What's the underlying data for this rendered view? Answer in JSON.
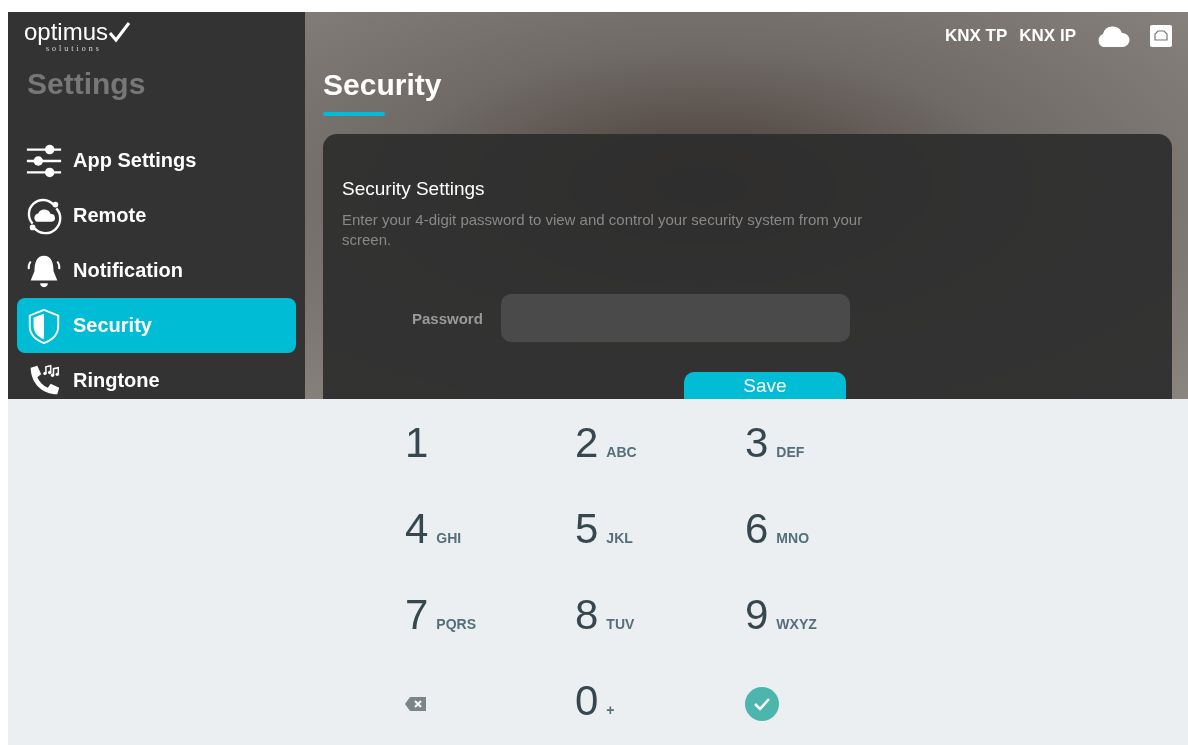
{
  "logo": {
    "name": "optimus",
    "tagline": "solutions"
  },
  "sidebar": {
    "title": "Settings",
    "items": [
      {
        "label": "App Settings",
        "selected": false
      },
      {
        "label": "Remote",
        "selected": false
      },
      {
        "label": "Notification",
        "selected": false
      },
      {
        "label": "Security",
        "selected": true
      },
      {
        "label": "Ringtone",
        "selected": false
      }
    ]
  },
  "status_bar": {
    "items": [
      "KNX TP",
      "KNX IP"
    ]
  },
  "page": {
    "title": "Security"
  },
  "card": {
    "title": "Security Settings",
    "description": "Enter your 4-digit password to view and control your security system from your screen.",
    "password_label": "Password",
    "save_button": "Save"
  },
  "keypad": {
    "keys": [
      {
        "kind": "digit",
        "digit": "1"
      },
      {
        "kind": "digit",
        "digit": "2",
        "letters": "ABC"
      },
      {
        "kind": "digit",
        "digit": "3",
        "letters": "DEF"
      },
      {
        "kind": "digit",
        "digit": "4",
        "letters": "GHI"
      },
      {
        "kind": "digit",
        "digit": "5",
        "letters": "JKL"
      },
      {
        "kind": "digit",
        "digit": "6",
        "letters": "MNO"
      },
      {
        "kind": "digit",
        "digit": "7",
        "letters": "PQRS"
      },
      {
        "kind": "digit",
        "digit": "8",
        "letters": "TUV"
      },
      {
        "kind": "digit",
        "digit": "9",
        "letters": "WXYZ"
      },
      {
        "kind": "backspace"
      },
      {
        "kind": "digit",
        "digit": "0",
        "letters": "+"
      },
      {
        "kind": "done"
      }
    ]
  }
}
